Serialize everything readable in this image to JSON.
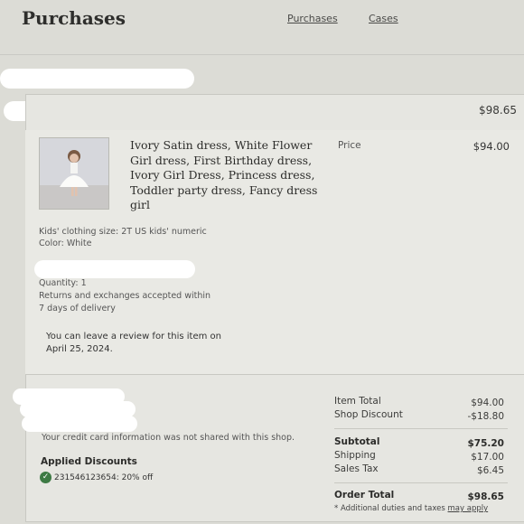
{
  "header": {
    "title": "Purchases",
    "nav": {
      "purchases": "Purchases",
      "cases": "Cases"
    }
  },
  "order": {
    "total": "$98.65",
    "item": {
      "title": "Ivory Satin dress, White Flower Girl dress, First Birthday dress, Ivory Girl Dress, Princess dress, Toddler party dress, Fancy dress girl",
      "price_label": "Price",
      "price": "$94.00",
      "size": "Kids' clothing size: 2T US kids' numeric",
      "color": "Color: White",
      "quantity": "Quantity: 1",
      "returns_line1": "Returns and exchanges accepted within",
      "returns_line2": "7 days of delivery",
      "review_line1": "You can leave a review for this item on",
      "review_line2": "April 25, 2024."
    },
    "payment_note": "Your credit card information was not shared with this shop.",
    "discounts": {
      "heading": "Applied Discounts",
      "code": "231546123654: 20% off"
    },
    "summary": {
      "item_total_label": "Item Total",
      "item_total": "$94.00",
      "shop_discount_label": "Shop Discount",
      "shop_discount": "-$18.80",
      "subtotal_label": "Subtotal",
      "subtotal": "$75.20",
      "shipping_label": "Shipping",
      "shipping": "$17.00",
      "sales_tax_label": "Sales Tax",
      "sales_tax": "$6.45",
      "order_total_label": "Order Total",
      "order_total": "$98.65",
      "duties_note": "* Additional duties and taxes",
      "duties_link": "may apply"
    }
  },
  "colors": {
    "background": "#dcdcd6",
    "card": "#e6e6e1",
    "check": "#3d7a44"
  }
}
